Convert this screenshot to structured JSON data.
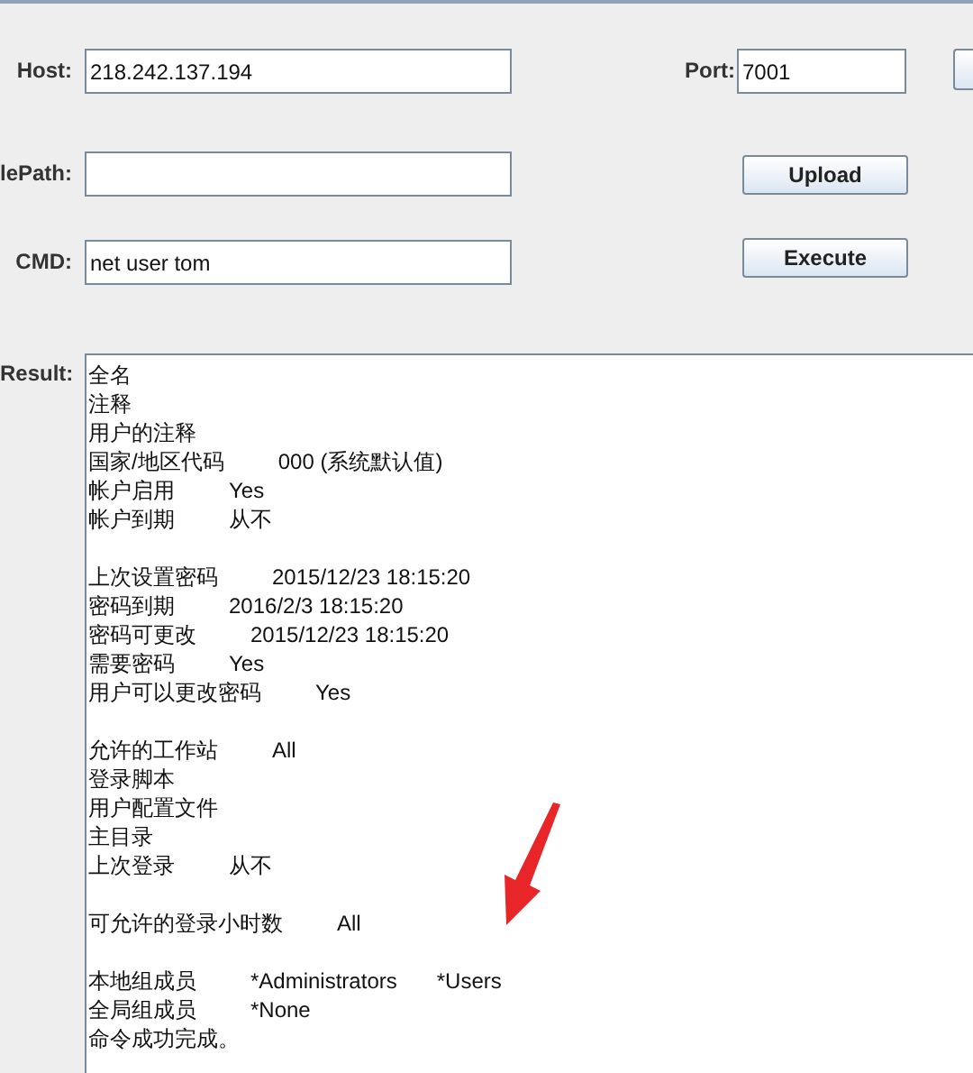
{
  "form": {
    "host": {
      "label": "Host:",
      "value": "218.242.137.194"
    },
    "port": {
      "label": "Port:",
      "value": "7001"
    },
    "file_path": {
      "label": "lePath:"
    },
    "cmd": {
      "label": "CMD:",
      "value": "net user tom"
    },
    "buttons": [
      {
        "label": "Upload"
      },
      {
        "label": "Execute"
      }
    ]
  },
  "result": {
    "label": "Result:",
    "groups": [
      [
        {
          "label": "全名"
        },
        {
          "label": "注释"
        },
        {
          "label": "用户的注释"
        },
        {
          "label": "国家/地区代码",
          "values": [
            "000 (系统默认值)"
          ]
        },
        {
          "label": "帐户启用",
          "values": [
            "Yes"
          ]
        },
        {
          "label": "帐户到期",
          "values": [
            "从不"
          ]
        }
      ],
      [
        {
          "label": "上次设置密码",
          "values": [
            "2015/12/23 18:15:20"
          ]
        },
        {
          "label": "密码到期",
          "values": [
            "2016/2/3 18:15:20"
          ]
        },
        {
          "label": "密码可更改",
          "values": [
            "2015/12/23 18:15:20"
          ]
        },
        {
          "label": "需要密码",
          "values": [
            "Yes"
          ]
        },
        {
          "label": "用户可以更改密码",
          "values": [
            "Yes"
          ]
        }
      ],
      [
        {
          "label": "允许的工作站",
          "values": [
            "All"
          ]
        },
        {
          "label": "登录脚本"
        },
        {
          "label": "用户配置文件"
        },
        {
          "label": "主目录"
        },
        {
          "label": "上次登录",
          "values": [
            "从不"
          ]
        }
      ],
      [
        {
          "label": "可允许的登录小时数",
          "values": [
            "All"
          ]
        }
      ],
      [
        {
          "label": "本地组成员",
          "values": [
            "*Administrators",
            "*Users"
          ]
        },
        {
          "label": "全局组成员",
          "values": [
            "*None"
          ]
        },
        {
          "label": "命令成功完成。"
        }
      ]
    ]
  },
  "annotation_arrow": true
}
